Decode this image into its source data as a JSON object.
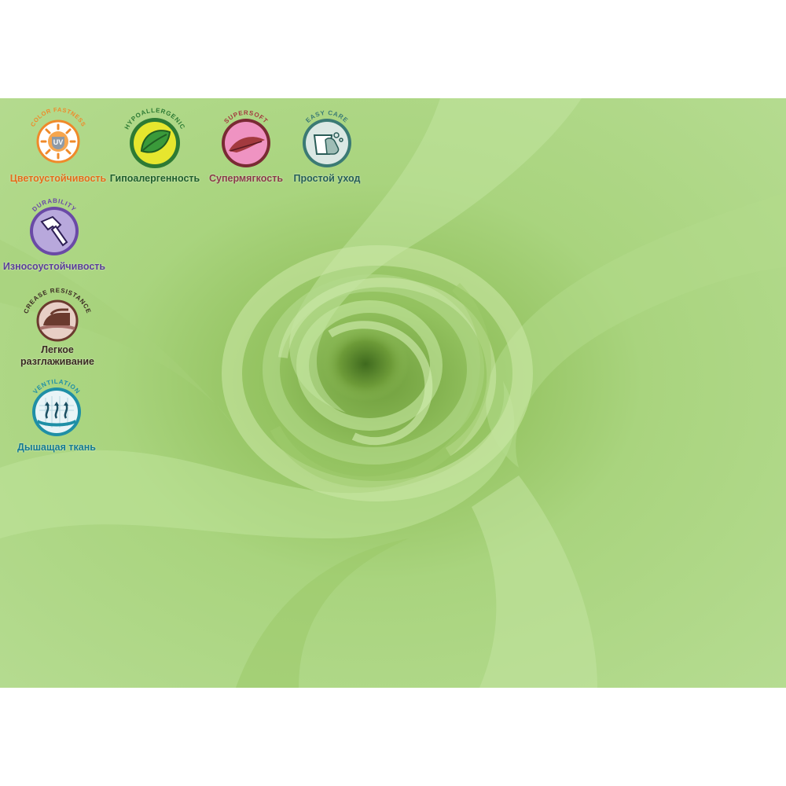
{
  "colors": {
    "fabric_light": "#b5dc8c",
    "fabric_mid": "#9ccb6c",
    "fabric_dark": "#6f9e3c",
    "uv_orange": "#ef8a2a",
    "hypo_green": "#2d7a34",
    "hypo_yellow": "#e6e62e",
    "soft_pink": "#ef93c2",
    "soft_red": "#a33a3f",
    "easy_teal": "#3b7a74",
    "durability_purple": "#6a4aa6",
    "crease_brown": "#6b3a2e",
    "ventilation_teal": "#1f8fa6"
  },
  "badges": [
    {
      "id": "uv",
      "ring_text": "COLOR FASTNESS",
      "icon_text": "UV",
      "label": "Цветоустойчивость",
      "icon": "sun-uv-icon",
      "label_color": "#e46c18"
    },
    {
      "id": "hypo",
      "ring_text": "HYPOALLERGENIC",
      "label": "Гипоалергенность",
      "icon": "leaf-icon",
      "label_color": "#1e5e2b"
    },
    {
      "id": "soft",
      "ring_text": "SUPERSOFT",
      "label": "Супермягкость",
      "icon": "feather-icon",
      "label_color": "#8a3a48"
    },
    {
      "id": "easy",
      "ring_text": "EASY CARE",
      "label": "Простой уход",
      "icon": "hand-wash-icon",
      "label_color": "#255e58"
    },
    {
      "id": "durability",
      "ring_text": "DURABILITY",
      "label": "Износоустойчивость",
      "icon": "hammer-icon",
      "label_color": "#5b3e99"
    },
    {
      "id": "crease",
      "ring_text": "CREASE RESISTANCE",
      "label_line1": "Легкое",
      "label_line2": "разглаживание",
      "icon": "iron-icon",
      "label_color": "#3a2a22"
    },
    {
      "id": "ventilation",
      "ring_text": "VENTILATION",
      "label": "Дышащая ткань",
      "icon": "airflow-icon",
      "label_color": "#137a93"
    }
  ]
}
